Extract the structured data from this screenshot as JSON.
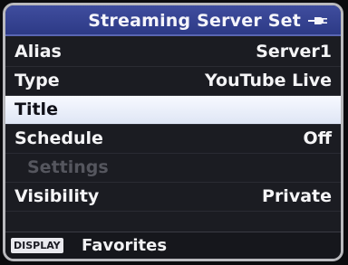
{
  "header": {
    "title": "Streaming Server Set",
    "icon": "connection-plug-icon"
  },
  "menu": {
    "items": [
      {
        "label": "Alias",
        "value": "Server1",
        "selected": false,
        "enabled": true
      },
      {
        "label": "Type",
        "value": "YouTube Live",
        "selected": false,
        "enabled": true
      },
      {
        "label": "Title",
        "value": "",
        "selected": true,
        "enabled": true
      },
      {
        "label": "Schedule",
        "value": "Off",
        "selected": false,
        "enabled": true
      },
      {
        "label": "Settings",
        "value": "",
        "selected": false,
        "enabled": false
      },
      {
        "label": "Visibility",
        "value": "Private",
        "selected": false,
        "enabled": true
      }
    ]
  },
  "footer": {
    "key_label": "DISPLAY",
    "action_label": "Favorites"
  },
  "colors": {
    "header_bg": "#34419a",
    "selected_bg": "#eef2fb",
    "disabled_text": "#55565e"
  }
}
